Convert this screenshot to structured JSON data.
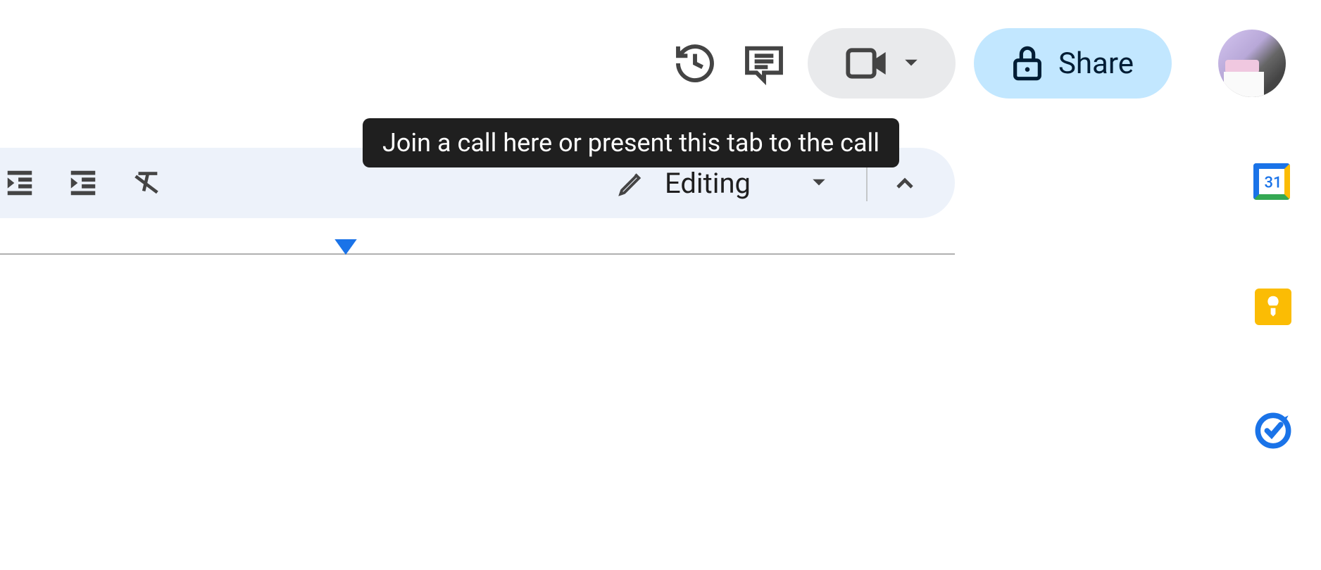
{
  "topbar": {
    "tooltip": "Join a call here or present this tab to the call",
    "share_label": "Share"
  },
  "toolbar": {
    "editing_label": "Editing"
  },
  "sidepanel": {
    "calendar_day": "31"
  }
}
